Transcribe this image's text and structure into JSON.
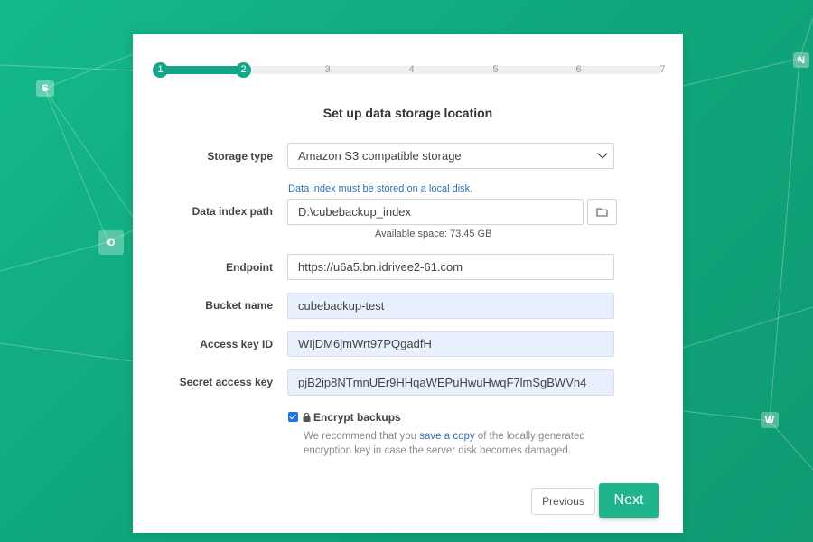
{
  "background_apps": [
    {
      "icon": "sharepoint-icon",
      "letter": "S"
    },
    {
      "icon": "outlook-icon",
      "letter": "O"
    },
    {
      "icon": "onenote-icon",
      "letter": "N"
    },
    {
      "icon": "word-icon",
      "letter": "W"
    }
  ],
  "stepper": {
    "steps": [
      "1",
      "2",
      "3",
      "4",
      "5",
      "6",
      "7"
    ],
    "current": 2,
    "accent": "#14a58a"
  },
  "title": "Set up data storage location",
  "form": {
    "storage_type": {
      "label": "Storage type",
      "value": "Amazon S3 compatible storage"
    },
    "data_index": {
      "note": "Data index must be stored on a local disk.",
      "label": "Data index path",
      "value": "D:\\cubebackup_index",
      "available": "Available space: 73.45 GB",
      "browse_icon": "folder-icon"
    },
    "endpoint": {
      "label": "Endpoint",
      "value": "https://u6a5.bn.idrivee2-61.com"
    },
    "bucket": {
      "label": "Bucket name",
      "value": "cubebackup-test"
    },
    "access_key": {
      "label": "Access key ID",
      "value": "WIjDM6jmWrt97PQgadfH"
    },
    "secret_key": {
      "label": "Secret access key",
      "value": "pjB2ip8NTmnUEr9HHqaWEPuHwuHwqF7lmSgBWVn4"
    },
    "encrypt": {
      "checked": true,
      "label": "Encrypt backups",
      "note_before": "We recommend that you",
      "note_link": "save a copy",
      "note_after": "of the locally generated encryption key in case the server disk becomes damaged."
    }
  },
  "buttons": {
    "previous": "Previous",
    "next": "Next"
  },
  "colors": {
    "accent": "#14a58a",
    "next_button": "#20b48c",
    "link": "#2f6fb6",
    "background": "#12ac80"
  }
}
